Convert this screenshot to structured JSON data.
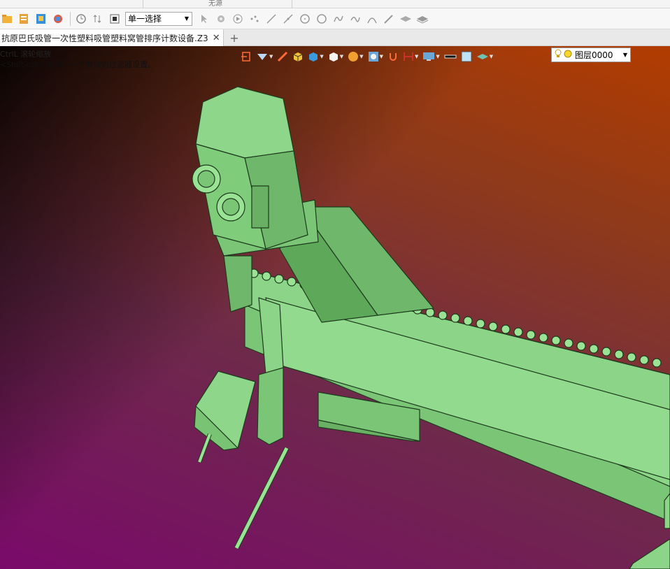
{
  "top_strip": {
    "caption": "无源"
  },
  "toolbar": {
    "select_mode": "单一选择",
    "icons": [
      "open-folder-icon",
      "export-icon",
      "import-icon",
      "save-icon",
      "history-icon",
      "sort-icon",
      "stop-icon",
      "pointer-icon",
      "filter-icon",
      "play-icon",
      "point-icon",
      "line-icon",
      "line2-icon",
      "circle-icon",
      "circle2-icon",
      "curve-icon",
      "spline-icon",
      "arc-icon",
      "pen-icon",
      "layers-icon",
      "layers2-icon"
    ]
  },
  "tab": {
    "title": "抗原巴氏吸管一次性塑料吸管塑料窝管排序计数设备.Z3",
    "close": "✕",
    "add": "+"
  },
  "viewport": {
    "message_line1": "CtrlL 滚轮缩放",
    "message_line2": "<Shift-roll> 选择下一个有效的过滤器设置。",
    "layer": "图层0000",
    "background_top_left": "#000000",
    "background_bottom_left": "#7a0a6a",
    "background_top_right": "#b23c00",
    "model_color": "#8dd68a"
  }
}
